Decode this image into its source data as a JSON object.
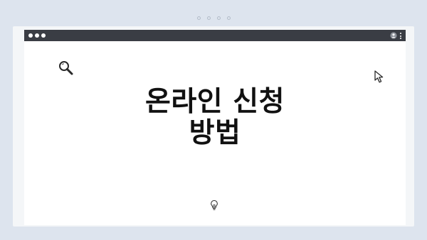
{
  "pager": {
    "dots": 4
  },
  "window": {
    "titlebar": {
      "controls": [
        "dot",
        "dot",
        "dot"
      ],
      "right_icons": [
        "user-icon",
        "kebab-menu-icon"
      ]
    },
    "icons": [
      "search-icon",
      "cursor-icon",
      "lightbulb-icon"
    ],
    "title_line1": "온라인 신청",
    "title_line2": "방법"
  },
  "colors": {
    "background": "#dde4ee",
    "titlebar": "#3a3d44",
    "window": "#ffffff",
    "text": "#111111"
  }
}
